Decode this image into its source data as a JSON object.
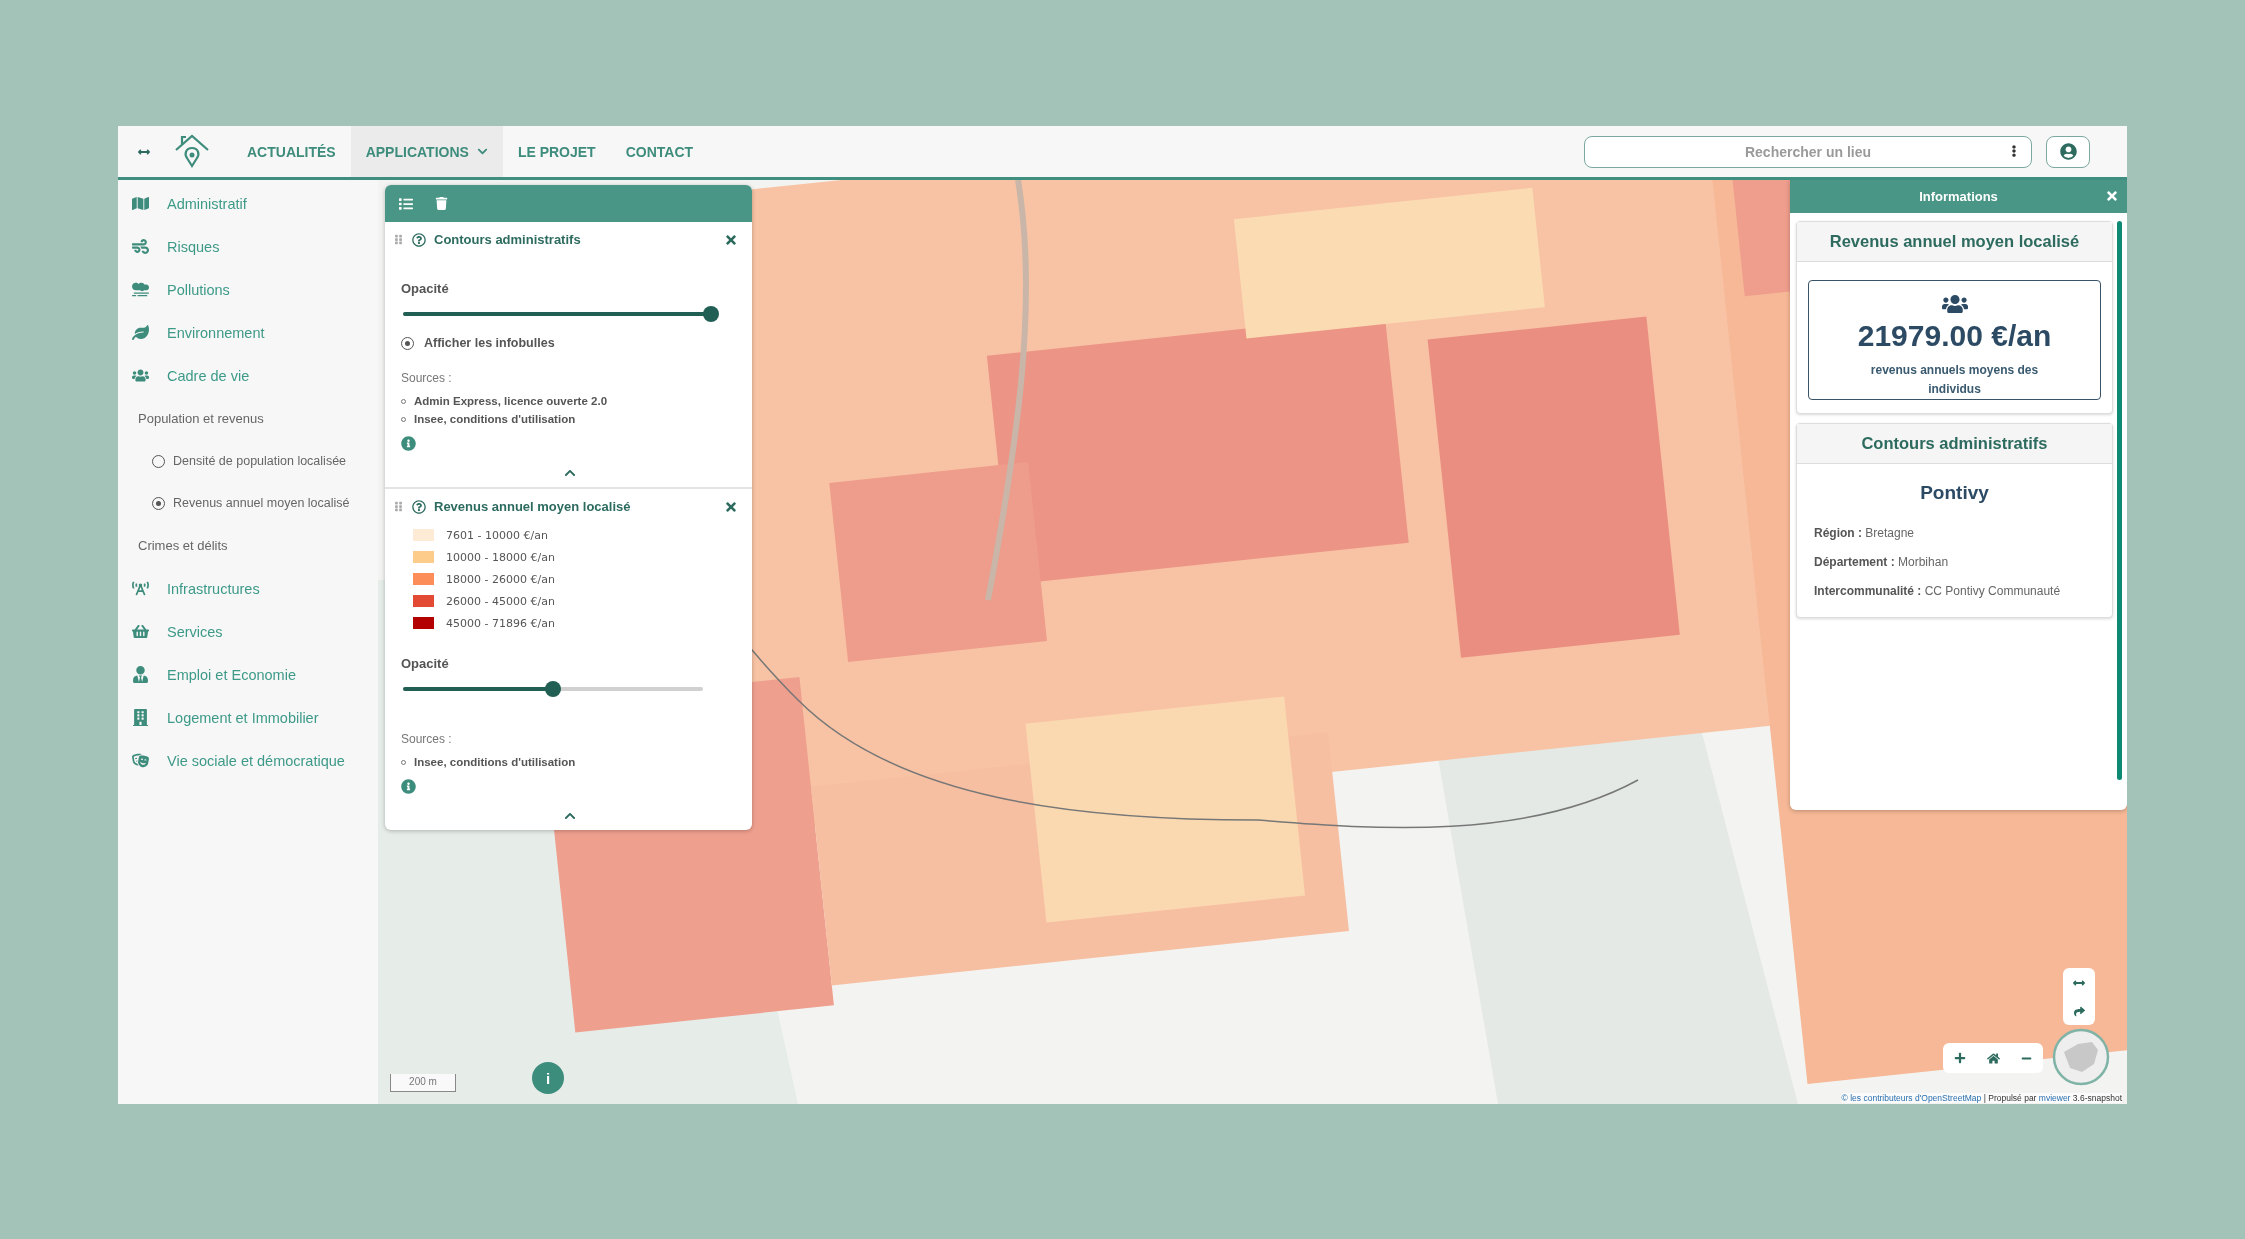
{
  "header": {
    "nav": [
      {
        "label": "ACTUALITÉS",
        "selected": false,
        "dropdown": false
      },
      {
        "label": "APPLICATIONS",
        "selected": true,
        "dropdown": true
      },
      {
        "label": "LE PROJET",
        "selected": false,
        "dropdown": false
      },
      {
        "label": "CONTACT",
        "selected": false,
        "dropdown": false
      }
    ],
    "search": {
      "placeholder": "Rechercher un lieu"
    }
  },
  "sidebar": {
    "items": [
      {
        "kind": "category",
        "label": "Administratif"
      },
      {
        "kind": "category",
        "label": "Risques"
      },
      {
        "kind": "category",
        "label": "Pollutions"
      },
      {
        "kind": "category",
        "label": "Environnement"
      },
      {
        "kind": "category",
        "label": "Cadre de vie"
      },
      {
        "kind": "group",
        "label": "Population et revenus",
        "children": [
          {
            "label": "Densité de population localisée",
            "selected": false
          },
          {
            "label": "Revenus annuel moyen localisé",
            "selected": true
          }
        ]
      },
      {
        "kind": "group",
        "label": "Crimes et délits"
      },
      {
        "kind": "category",
        "label": "Infrastructures"
      },
      {
        "kind": "category",
        "label": "Services"
      },
      {
        "kind": "category",
        "label": "Emploi et Economie"
      },
      {
        "kind": "category",
        "label": "Logement et Immobilier"
      },
      {
        "kind": "category",
        "label": "Vie sociale et démocratique"
      }
    ]
  },
  "layers": [
    {
      "title": "Contours administratifs",
      "opacity_label": "Opacité",
      "level": 1,
      "tooltip": {
        "label": "Afficher les infobulles",
        "checked": true
      },
      "sources_label": "Sources :",
      "sources": [
        "Admin Express, licence ouverte 2.0",
        "Insee, conditions d'utilisation"
      ]
    },
    {
      "title": "Revenus annuel moyen localisé",
      "legend": [
        {
          "label": "7601 - 10000 €/an",
          "color": "#fdebd6"
        },
        {
          "label": "10000 - 18000 €/an",
          "color": "#fdcc8a"
        },
        {
          "label": "18000 - 26000 €/an",
          "color": "#fc8d59"
        },
        {
          "label": "26000 - 45000 €/an",
          "color": "#e34a33"
        },
        {
          "label": "45000 - 71896 €/an",
          "color": "#b30000"
        }
      ],
      "opacity_label": "Opacité",
      "level": 0.5,
      "sources_label": "Sources :",
      "sources": [
        "Insee, conditions d'utilisation"
      ]
    }
  ],
  "info_panel": {
    "title": "Informations",
    "cards": [
      {
        "kind": "stat",
        "title": "Revenus annuel moyen localisé",
        "value": "21979.00 €/an",
        "caption": "revenus annuels moyens des individus"
      },
      {
        "kind": "details",
        "title": "Contours administratifs",
        "name": "Pontivy",
        "fields": [
          "**Région :** Bretagne",
          "**Département :** Morbihan",
          "**Intercommunalité :** CC Pontivy Communauté"
        ]
      }
    ]
  },
  "map": {
    "scale": "200 m",
    "info_button": "i",
    "attribution": [
      {
        "text": "© les contributeurs d'OpenStreetMap",
        "link": true
      },
      {
        "text": "| Propulsé par",
        "link": false
      },
      {
        "text": "mviewer",
        "link": true
      },
      {
        "text": "3.6-snapshot",
        "link": false
      }
    ]
  }
}
